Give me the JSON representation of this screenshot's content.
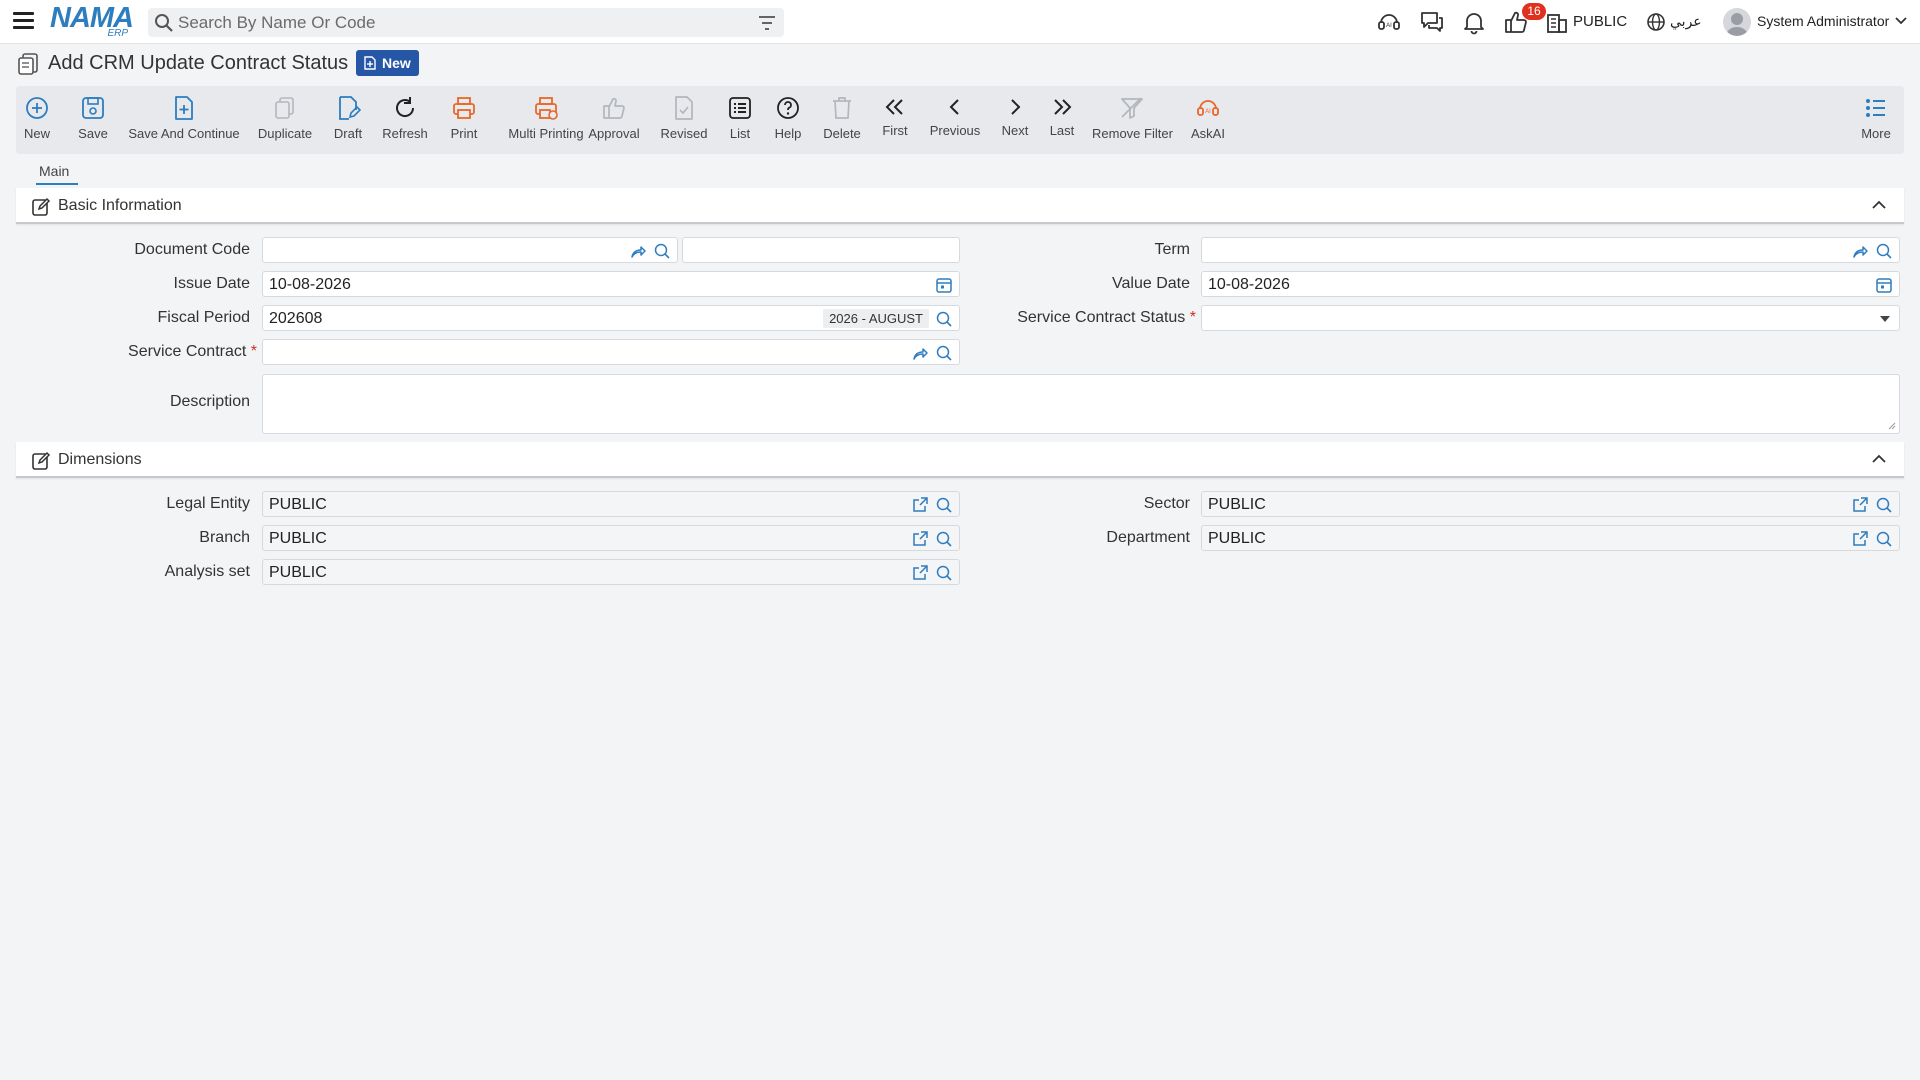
{
  "topbar": {
    "logo_main": "NAMA",
    "logo_sub": "ERP",
    "search_placeholder": "Search By Name Or Code",
    "notification_count": "16",
    "company": "PUBLIC",
    "language": "عربي",
    "user": "System Administrator"
  },
  "page": {
    "title": "Add CRM Update Contract Status",
    "status_badge": "New"
  },
  "toolbar": {
    "new": "New",
    "save": "Save",
    "save_continue": "Save And Continue",
    "duplicate": "Duplicate",
    "draft": "Draft",
    "refresh": "Refresh",
    "print": "Print",
    "multi_printing": "Multi Printing",
    "approval": "Approval",
    "revised": "Revised",
    "list": "List",
    "help": "Help",
    "delete": "Delete",
    "first": "First",
    "previous": "Previous",
    "next": "Next",
    "last": "Last",
    "remove_filter": "Remove Filter",
    "askai": "AskAI",
    "more": "More"
  },
  "tabs": {
    "main": "Main"
  },
  "basic": {
    "title": "Basic Information",
    "document_code": {
      "label": "Document Code",
      "value": "",
      "value2": ""
    },
    "term": {
      "label": "Term",
      "value": ""
    },
    "issue_date": {
      "label": "Issue Date",
      "value": "10-08-2026"
    },
    "value_date": {
      "label": "Value Date",
      "value": "10-08-2026"
    },
    "fiscal_period": {
      "label": "Fiscal Period",
      "value": "202608",
      "period_name": "2026 - AUGUST"
    },
    "service_contract_status": {
      "label": "Service Contract Status",
      "value": ""
    },
    "service_contract": {
      "label": "Service Contract",
      "value": ""
    },
    "description": {
      "label": "Description",
      "value": ""
    },
    "required_mark": "*"
  },
  "dimensions": {
    "title": "Dimensions",
    "legal_entity": {
      "label": "Legal Entity",
      "value": "PUBLIC"
    },
    "sector": {
      "label": "Sector",
      "value": "PUBLIC"
    },
    "branch": {
      "label": "Branch",
      "value": "PUBLIC"
    },
    "department": {
      "label": "Department",
      "value": "PUBLIC"
    },
    "analysis_set": {
      "label": "Analysis set",
      "value": "PUBLIC"
    }
  },
  "colors": {
    "accent": "#2e7dbf",
    "badge_new": "#2656a6",
    "orange": "#e8672a",
    "required": "#d0302b",
    "notification": "#e0301e"
  },
  "icons": {
    "menu": "hamburger-icon",
    "search": "search-icon",
    "filter": "filter-icon",
    "lookup": "lookup-search-icon",
    "open": "external-link-icon",
    "share": "share-arrow-icon",
    "calendar": "calendar-icon"
  }
}
